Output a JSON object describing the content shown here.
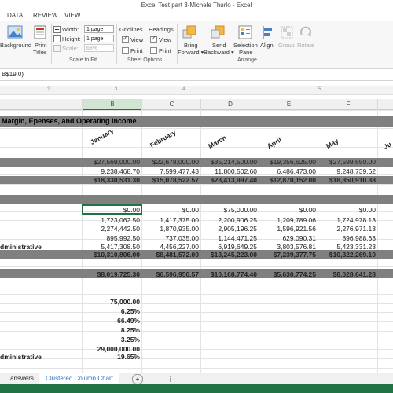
{
  "window": {
    "title": "Excel Test part 3-Michele Thurlo - Excel"
  },
  "menu": {
    "items": [
      "DATA",
      "REVIEW",
      "VIEW"
    ]
  },
  "ribbon": {
    "background_label": "Background",
    "print_titles_label": "Print Titles",
    "print_titles_line1": "Print",
    "print_titles_line2": "Titles",
    "width_label": "Width:",
    "width_value": "1 page",
    "height_label": "Height:",
    "height_value": "1 page",
    "scale_label": "Scale:",
    "scale_value": "68%",
    "scale_to_fit_label": "Scale to Fit",
    "gridlines_label": "Gridlines",
    "headings_label": "Headings",
    "view_label": "View",
    "print_label": "Print",
    "sheet_options_label": "Sheet Options",
    "bring_forward_line1": "Bring",
    "bring_forward_line2": "Forward ▾",
    "send_backward_line1": "Send",
    "send_backward_line2": "Backward ▾",
    "selection_pane_line1": "Selection",
    "selection_pane_line2": "Pane",
    "align_label": "Align",
    "group_label": "Group",
    "rotate_label": "Rotate",
    "arrange_label": "Arrange"
  },
  "formula_bar": {
    "text": "B$19,0)"
  },
  "ruler": {
    "marks": [
      "2",
      "3",
      "4",
      "5"
    ]
  },
  "columns": [
    "B",
    "C",
    "D",
    "E",
    "F"
  ],
  "sheet": {
    "heading": "Margin, Epenses, and Operating Income",
    "months": [
      "January",
      "February",
      "March",
      "April",
      "May",
      "Ju"
    ],
    "rows": [
      {
        "label": "",
        "values": [
          "$27,569,000.00",
          "$22,678,000.00",
          "$35,214,500.00",
          "$19,356,625.00",
          "$27,599,650.00",
          "$2"
        ]
      },
      {
        "label": "",
        "values": [
          "9,238,468.70",
          "7,599,477.43",
          "11,800,502.60",
          "6,486,473.00",
          "9,248,739.62",
          ""
        ]
      },
      {
        "label": "",
        "values": [
          "$18,330,531.30",
          "$15,078,522.57",
          "$23,413,997.40",
          "$12,870,152.00",
          "$18,350,910.38",
          "$1"
        ]
      },
      {
        "label": "",
        "values": [
          "$0.00",
          "$0.00",
          "$75,000.00",
          "$0.00",
          "$0.00",
          ""
        ]
      },
      {
        "label": "",
        "values": [
          "1,723,062.50",
          "1,417,375.00",
          "2,200,906.25",
          "1,209,789.06",
          "1,724,978.13",
          ""
        ]
      },
      {
        "label": "",
        "values": [
          "2,274,442.50",
          "1,870,935.00",
          "2,905,196.25",
          "1,596,921.56",
          "2,276,971.13",
          ""
        ]
      },
      {
        "label": "",
        "values": [
          "895,992.50",
          "737,035.00",
          "1,144,471.25",
          "629,090.31",
          "896,988.63",
          ""
        ]
      },
      {
        "label": "dministrative",
        "values": [
          "5,417,308.50",
          "4,456,227.00",
          "6,919,649.25",
          "3,803,576.81",
          "5,423,331.23",
          ""
        ]
      },
      {
        "label": "",
        "values": [
          "$10,310,806.00",
          "$8,481,572.00",
          "$13,245,223.00",
          "$7,239,377.75",
          "$10,322,269.10",
          "$"
        ]
      },
      {
        "label": "",
        "values": [
          "$8,019,725.30",
          "$6,596,950.57",
          "$10,168,774.40",
          "$5,630,774.25",
          "$8,028,641.28",
          "$"
        ]
      }
    ],
    "assumptions": [
      {
        "label": "",
        "value": "75,000.00"
      },
      {
        "label": "",
        "value": "6.25%"
      },
      {
        "label": "",
        "value": "66.49%"
      },
      {
        "label": "",
        "value": "8.25%"
      },
      {
        "label": "",
        "value": "3.25%"
      },
      {
        "label": "",
        "value": "29,000,000.00"
      },
      {
        "label": "dministrative",
        "value": "19.65%"
      }
    ]
  },
  "tabs": {
    "answers": "answers",
    "chart": "Clustered Column Chart",
    "add": "+"
  },
  "colors": {
    "accent": "#217346",
    "band": "#808080",
    "tab_active": "#2b72c4"
  }
}
